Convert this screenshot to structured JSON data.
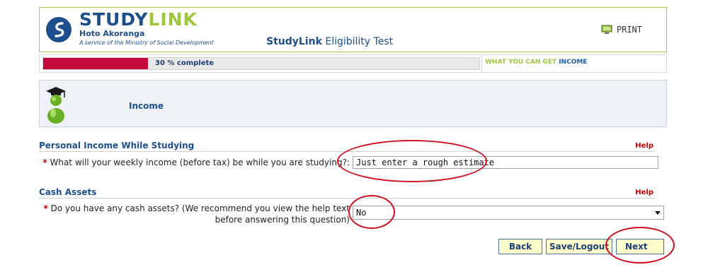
{
  "header": {
    "brand_word_1": "STUDY",
    "brand_word_2": "LINK",
    "brand_subtitle": "Hoto Akoranga",
    "brand_tagline": "A service of the Ministry of Social Development",
    "app_name": "StudyLink",
    "app_subtitle": "Eligibility Test",
    "print_label": "PRINT"
  },
  "progress": {
    "percent_complete": 30,
    "label": "30 % complete",
    "stage_label": "WHAT YOU CAN GET",
    "current_step": "INCOME",
    "fill_color": "#c4093a"
  },
  "banner": {
    "title": "Income",
    "icon": "graduate-icon"
  },
  "sections": [
    {
      "title": "Personal Income While Studying",
      "help_label": "Help",
      "question_marker": "*",
      "question": "What will your weekly income (before tax) be while you are studying?:",
      "input_value": "Just enter a rough estimate"
    },
    {
      "title": "Cash Assets",
      "help_label": "Help",
      "question_marker": "*",
      "question_line_1": "Do you have any cash assets? (We recommend you view the help text",
      "question_line_2": "before answering this question)",
      "selected_value": "No"
    }
  ],
  "buttons": {
    "back": "Back",
    "save_logout": "Save/Logout",
    "next": "Next"
  },
  "colors": {
    "brand_blue": "#1c4f8c",
    "brand_green": "#9ec63b",
    "help_red": "#cc0000",
    "annotation_red": "#d0101f",
    "button_bg": "#ffffcc"
  }
}
